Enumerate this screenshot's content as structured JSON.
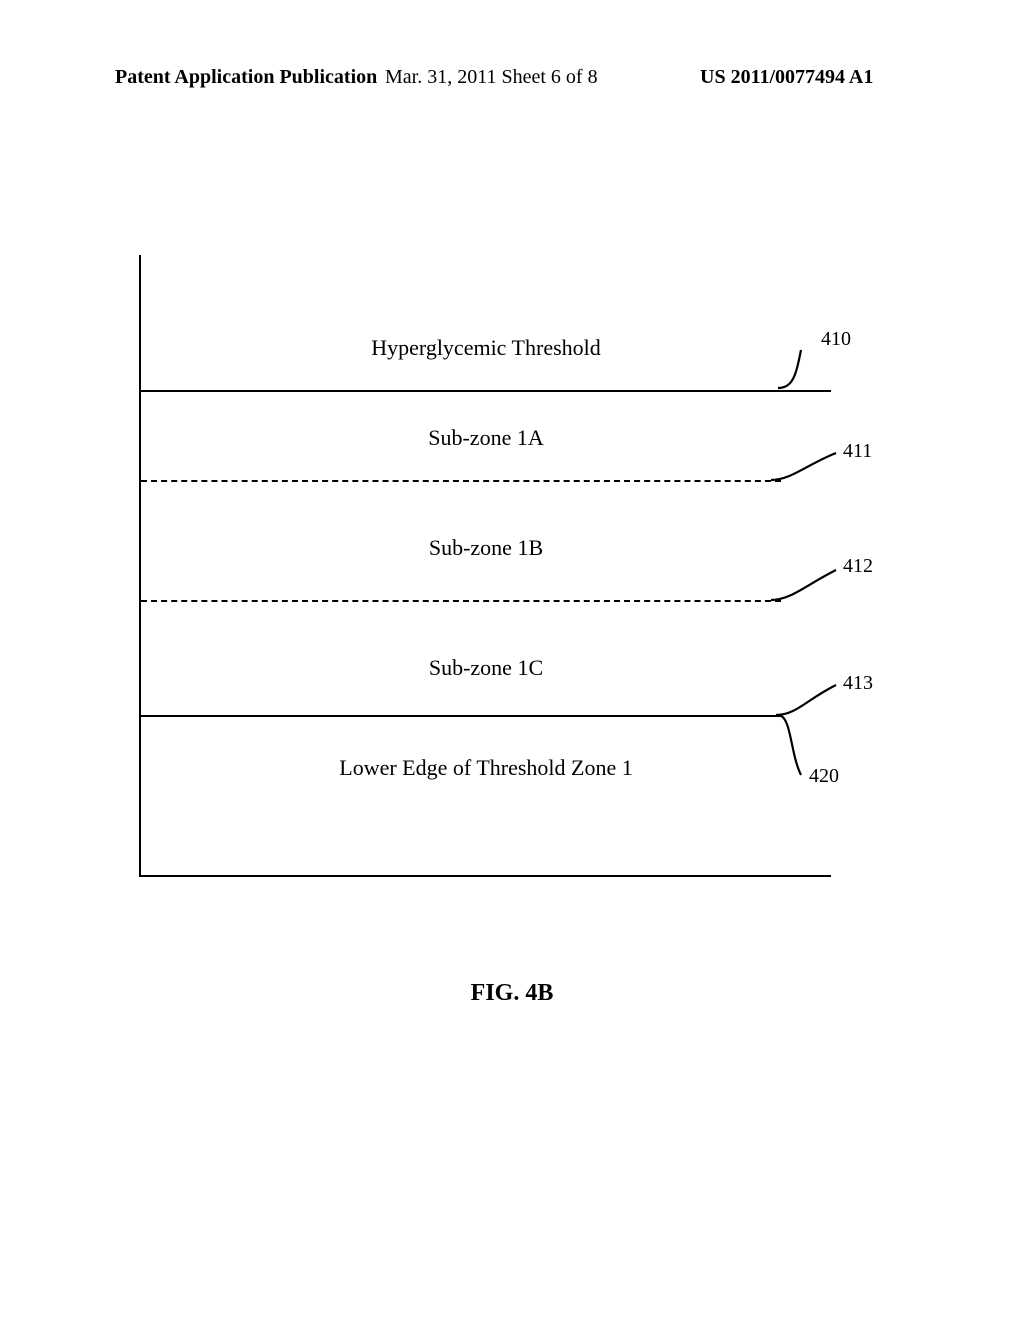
{
  "header": {
    "left": "Patent Application Publication",
    "center": "Mar. 31, 2011 Sheet 6 of 8",
    "right": "US 2011/0077494 A1"
  },
  "diagram": {
    "rows": {
      "hyper": "Hyperglycemic Threshold",
      "sub1a": "Sub-zone 1A",
      "sub1b": "Sub-zone 1B",
      "sub1c": "Sub-zone 1C",
      "lower": "Lower Edge of Threshold Zone 1"
    },
    "labels": {
      "l410": "410",
      "l411": "411",
      "l412": "412",
      "l413": "413",
      "l420": "420"
    }
  },
  "caption": "FIG. 4B"
}
